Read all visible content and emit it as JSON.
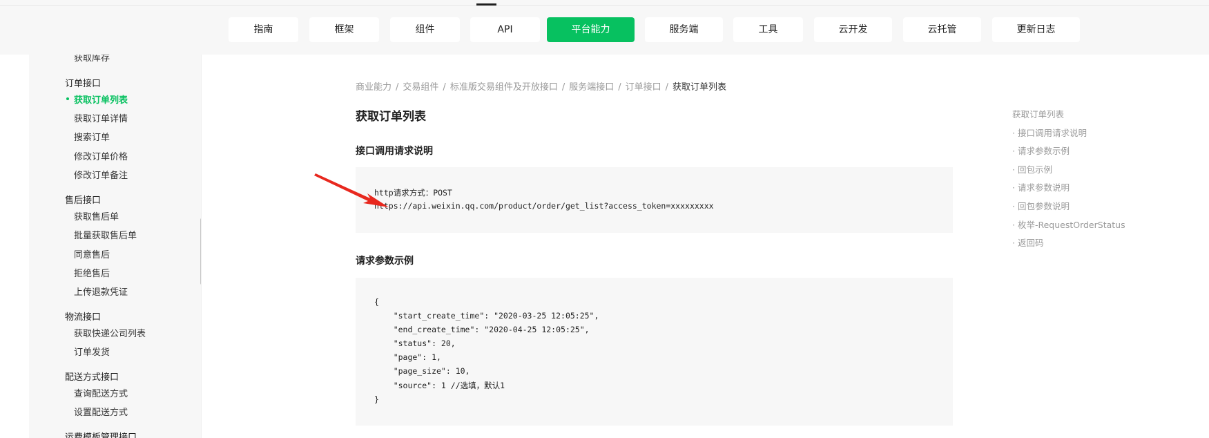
{
  "nav": {
    "items": [
      "指南",
      "框架",
      "组件",
      "API",
      "平台能力",
      "服务端",
      "工具",
      "云开发",
      "云托管",
      "更新日志"
    ],
    "active": "平台能力",
    "accent": "#07c160"
  },
  "sidebar": {
    "top_item": "获取库存",
    "groups": [
      {
        "title": "订单接口",
        "items": [
          "获取订单列表",
          "获取订单详情",
          "搜索订单",
          "修改订单价格",
          "修改订单备注"
        ]
      },
      {
        "title": "售后接口",
        "items": [
          "获取售后单",
          "批量获取售后单",
          "同意售后",
          "拒绝售后",
          "上传退款凭证"
        ]
      },
      {
        "title": "物流接口",
        "items": [
          "获取快递公司列表",
          "订单发货"
        ]
      },
      {
        "title": "配送方式接口",
        "items": [
          "查询配送方式",
          "设置配送方式"
        ]
      },
      {
        "title": "运费模板管理接口",
        "items": []
      }
    ],
    "active_item": "获取订单列表"
  },
  "breadcrumb": [
    "商业能力",
    "交易组件",
    "标准版交易组件及开放接口",
    "服务端接口",
    "订单接口",
    "获取订单列表"
  ],
  "page_title": "获取订单列表",
  "sections": {
    "request_title": "接口调用请求说明",
    "request_lines": [
      "http请求方式：POST",
      "https://api.weixin.qq.com/product/order/get_list?access_token=xxxxxxxxx"
    ],
    "example_title": "请求参数示例",
    "example_lines": [
      "{",
      "    \"start_create_time\": \"2020-03-25 12:05:25\",",
      "    \"end_create_time\": \"2020-04-25 12:05:25\",",
      "    \"status\": 20,",
      "    \"page\": 1,",
      "    \"page_size\": 10,",
      "    \"source\": 1 //选填，默认1",
      "}"
    ]
  },
  "toc": [
    "获取订单列表",
    "· 接口调用请求说明",
    "· 请求参数示例",
    "· 回包示例",
    "· 请求参数说明",
    "· 回包参数说明",
    "· 枚举-RequestOrderStatus",
    "· 返回码"
  ],
  "annotation_color": "#e8281e"
}
